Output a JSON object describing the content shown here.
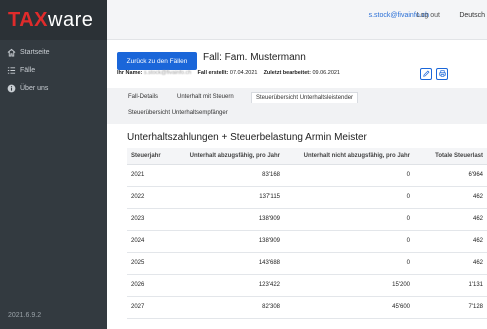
{
  "brand": {
    "tax": "TAX",
    "ware": "ware"
  },
  "sidebar": {
    "items": [
      {
        "label": "Startseite",
        "icon": "home-icon"
      },
      {
        "label": "Fälle",
        "icon": "list-icon"
      },
      {
        "label": "Über uns",
        "icon": "info-icon"
      }
    ],
    "version": "2021.6.9.2"
  },
  "topbar": {
    "email": "s.stock@fivainfo.ch",
    "logout": "Log out",
    "language": "Deutsch"
  },
  "header": {
    "back_button": "Zurück zu den Fällen",
    "case_title": "Fall: Fam. Mustermann",
    "name_label": "Ihr Name:",
    "name_value": "s.stock@fivainfo.ch",
    "created_label": "Fall erstellt:",
    "created_value": "07.04.2021",
    "edited_label": "Zuletzt bearbeitet:",
    "edited_value": "09.06.2021"
  },
  "tabs": [
    "Fall-Details",
    "Unterhalt mit Steuern",
    "Steuerübersicht Unterhaltsleistender",
    "Steuerübersicht Unterhaltsempfänger"
  ],
  "section_title": "Unterhaltszahlungen + Steuerbelastung Armin Meister",
  "table": {
    "headers": [
      "Steuerjahr",
      "Unterhalt abzugsfähig, pro Jahr",
      "Unterhalt nicht abzugsfähig, pro Jahr",
      "Totale Steuerlast"
    ],
    "rows": [
      [
        "2021",
        "83'168",
        "0",
        "6'964"
      ],
      [
        "2022",
        "137'115",
        "0",
        "462"
      ],
      [
        "2023",
        "138'909",
        "0",
        "462"
      ],
      [
        "2024",
        "138'909",
        "0",
        "462"
      ],
      [
        "2025",
        "143'688",
        "0",
        "462"
      ],
      [
        "2026",
        "123'422",
        "15'200",
        "1'131"
      ],
      [
        "2027",
        "82'308",
        "45'600",
        "7'128"
      ]
    ]
  }
}
